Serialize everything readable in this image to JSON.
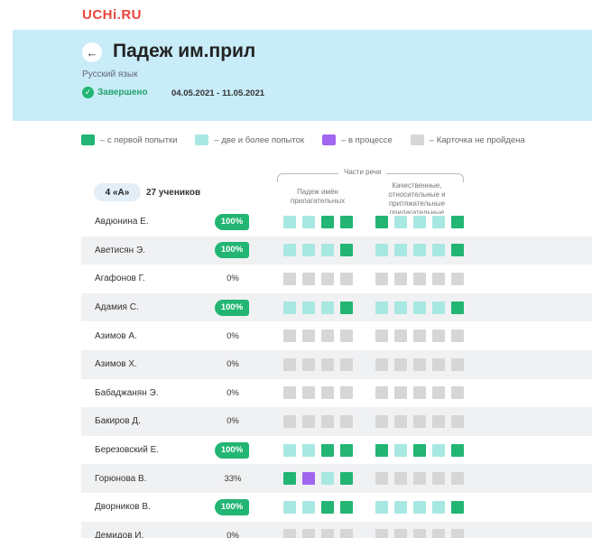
{
  "logo": "UCHi.RU",
  "header": {
    "title": "Падеж им.прил",
    "subject": "Русский язык",
    "status": "Завершено",
    "dates": "04.05.2021 - 11.05.2021"
  },
  "legend": [
    {
      "label": "– с первой попытки",
      "color": "#22b573"
    },
    {
      "label": "– две и более попыток",
      "color": "#a8e8e2"
    },
    {
      "label": "– в процессе",
      "color": "#a066f0"
    },
    {
      "label": "– Карточка не пройдена",
      "color": "#d6d6d6"
    }
  ],
  "group_label": "Части речи",
  "columns": [
    "Падеж имён прилагательных",
    "Качественные, относительные и притяжательные прилагательные"
  ],
  "class_badge": "4 «А»",
  "student_count": "27 учеников",
  "colors": {
    "g": "#22b573",
    "t": "#a8e8e2",
    "p": "#a066f0",
    "x": "#d6d6d6"
  },
  "students": [
    {
      "name": "Авдюнина Е.",
      "pct": "100%",
      "g1": "ttgg",
      "g2": "gtttg"
    },
    {
      "name": "Аветисян Э.",
      "pct": "100%",
      "g1": "tttg",
      "g2": "ttttg"
    },
    {
      "name": "Агафонов Г.",
      "pct": "0%",
      "g1": "xxxx",
      "g2": "xxxxx"
    },
    {
      "name": "Адамия С.",
      "pct": "100%",
      "g1": "tttg",
      "g2": "ttttg"
    },
    {
      "name": "Азимов А.",
      "pct": "0%",
      "g1": "xxxx",
      "g2": "xxxxx"
    },
    {
      "name": "Азимов Х.",
      "pct": "0%",
      "g1": "xxxx",
      "g2": "xxxxx"
    },
    {
      "name": "Бабаджанян Э.",
      "pct": "0%",
      "g1": "xxxx",
      "g2": "xxxxx"
    },
    {
      "name": "Бакиров Д.",
      "pct": "0%",
      "g1": "xxxx",
      "g2": "xxxxx"
    },
    {
      "name": "Березовский Е.",
      "pct": "100%",
      "g1": "ttgg",
      "g2": "gtgtg"
    },
    {
      "name": "Горюнова В.",
      "pct": "33%",
      "g1": "gptg",
      "g2": "xxxxx"
    },
    {
      "name": "Дворников В.",
      "pct": "100%",
      "g1": "ttgg",
      "g2": "ttttg"
    },
    {
      "name": "Демидов И.",
      "pct": "0%",
      "g1": "xxxx",
      "g2": "xxxxx"
    }
  ]
}
